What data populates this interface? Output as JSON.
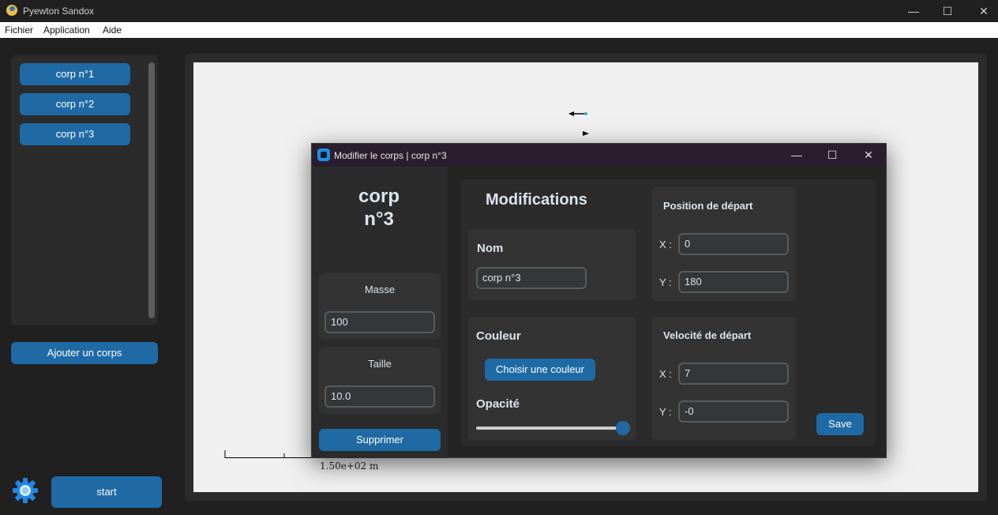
{
  "window": {
    "title": "Pyewton Sandox",
    "minimize_glyph": "—",
    "maximize_glyph": "☐",
    "close_glyph": "✕"
  },
  "menu": [
    "Fichier",
    "Application",
    "Aide"
  ],
  "sidebar": {
    "bodies": [
      "corp n°1",
      "corp n°2",
      "corp n°3"
    ],
    "add_label": "Ajouter un corps",
    "start_label": "start",
    "settings_icon": "gear-icon"
  },
  "canvas": {
    "scale_label": "1.50e+02 m",
    "background": "#f0f0f0"
  },
  "dialog": {
    "title": "Modifier le corps | corp n°3",
    "body_name": "corp\nn°3",
    "mass": {
      "label": "Masse",
      "value": "100"
    },
    "size": {
      "label": "Taille",
      "value": "10.0"
    },
    "delete_label": "Supprimer",
    "modifications_title": "Modifications",
    "name_section": {
      "label": "Nom",
      "value": "corp n°3"
    },
    "color_section": {
      "label": "Couleur",
      "button_label": "Choisir une couleur",
      "opacity_label": "Opacité",
      "opacity_value": 1.0
    },
    "start_position": {
      "label": "Position de départ",
      "x_label": "X :",
      "x_value": "0",
      "y_label": "Y :",
      "y_value": "180"
    },
    "start_velocity": {
      "label": "Velocité de départ",
      "x_label": "X :",
      "x_value": "7",
      "y_label": "Y :",
      "y_value": "-0"
    },
    "save_label": "Save"
  },
  "colors": {
    "accent": "#1f6aa5",
    "background": "#202020",
    "panel": "#2b2b2b",
    "dialog_titlebar": "#2a1e2e"
  }
}
